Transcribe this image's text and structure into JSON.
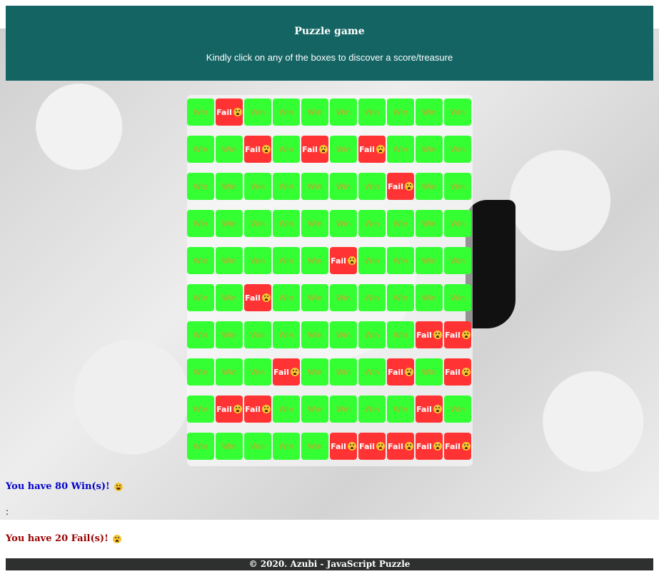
{
  "header": {
    "title": "Puzzle game",
    "subtitle": "Kindly click on any of the boxes to discover a score/treasure"
  },
  "labels": {
    "win": "Win",
    "fail": "Fail"
  },
  "grid": [
    [
      "win",
      "fail",
      "win",
      "win",
      "win",
      "win",
      "win",
      "win",
      "win",
      "win"
    ],
    [
      "win",
      "win",
      "fail",
      "win",
      "fail",
      "win",
      "fail",
      "win",
      "win",
      "win"
    ],
    [
      "win",
      "win",
      "win",
      "win",
      "win",
      "win",
      "win",
      "fail",
      "win",
      "win"
    ],
    [
      "win",
      "win",
      "win",
      "win",
      "win",
      "win",
      "win",
      "win",
      "win",
      "win"
    ],
    [
      "win",
      "win",
      "win",
      "win",
      "win",
      "fail",
      "win",
      "win",
      "win",
      "win"
    ],
    [
      "win",
      "win",
      "fail",
      "win",
      "win",
      "win",
      "win",
      "win",
      "win",
      "win"
    ],
    [
      "win",
      "win",
      "win",
      "win",
      "win",
      "win",
      "win",
      "win",
      "fail",
      "fail"
    ],
    [
      "win",
      "win",
      "win",
      "fail",
      "win",
      "win",
      "win",
      "fail",
      "win",
      "fail"
    ],
    [
      "win",
      "fail",
      "fail",
      "win",
      "win",
      "win",
      "win",
      "win",
      "fail",
      "win"
    ],
    [
      "win",
      "win",
      "win",
      "win",
      "win",
      "fail",
      "fail",
      "fail",
      "fail",
      "fail"
    ]
  ],
  "summary": {
    "wins_text": "You have 80 Win(s)!",
    "separator": ":",
    "fails_text": "You have 20 Fail(s)!"
  },
  "footer": {
    "text": "© 2020. Azubi - JavaScript Puzzle"
  },
  "colors": {
    "header_bg": "#146464",
    "win_box": "#33ff33",
    "fail_box": "#ff3333",
    "wins_text": "#0000cc",
    "fails_text": "#990000",
    "footer_bg": "#2e302f"
  }
}
